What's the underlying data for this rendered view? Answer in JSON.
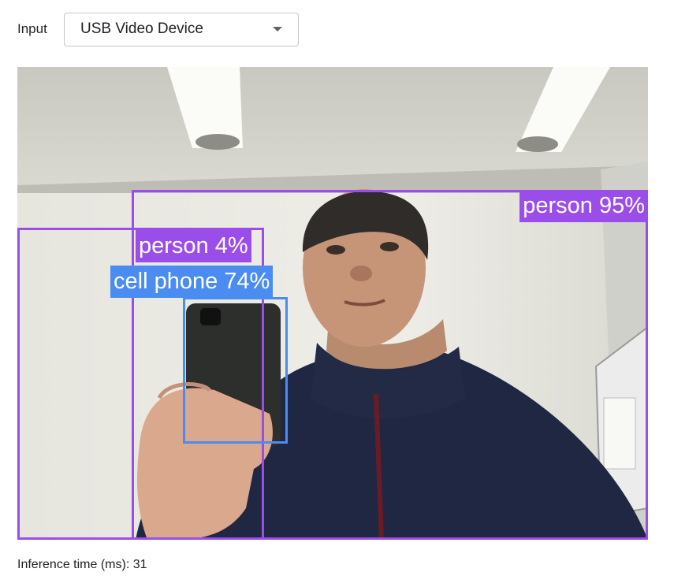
{
  "input": {
    "label": "Input",
    "selected_device": "USB Video Device"
  },
  "colors": {
    "person": "#9b4dea",
    "cell_phone": "#4a8cf0"
  },
  "detections": [
    {
      "label": "person 95%",
      "class": "person"
    },
    {
      "label": "person 4%",
      "class": "person"
    },
    {
      "label": "cell phone 74%",
      "class": "cell_phone"
    }
  ],
  "stats": {
    "inference_time_label": "Inference time (ms):",
    "inference_time_value": "31"
  }
}
